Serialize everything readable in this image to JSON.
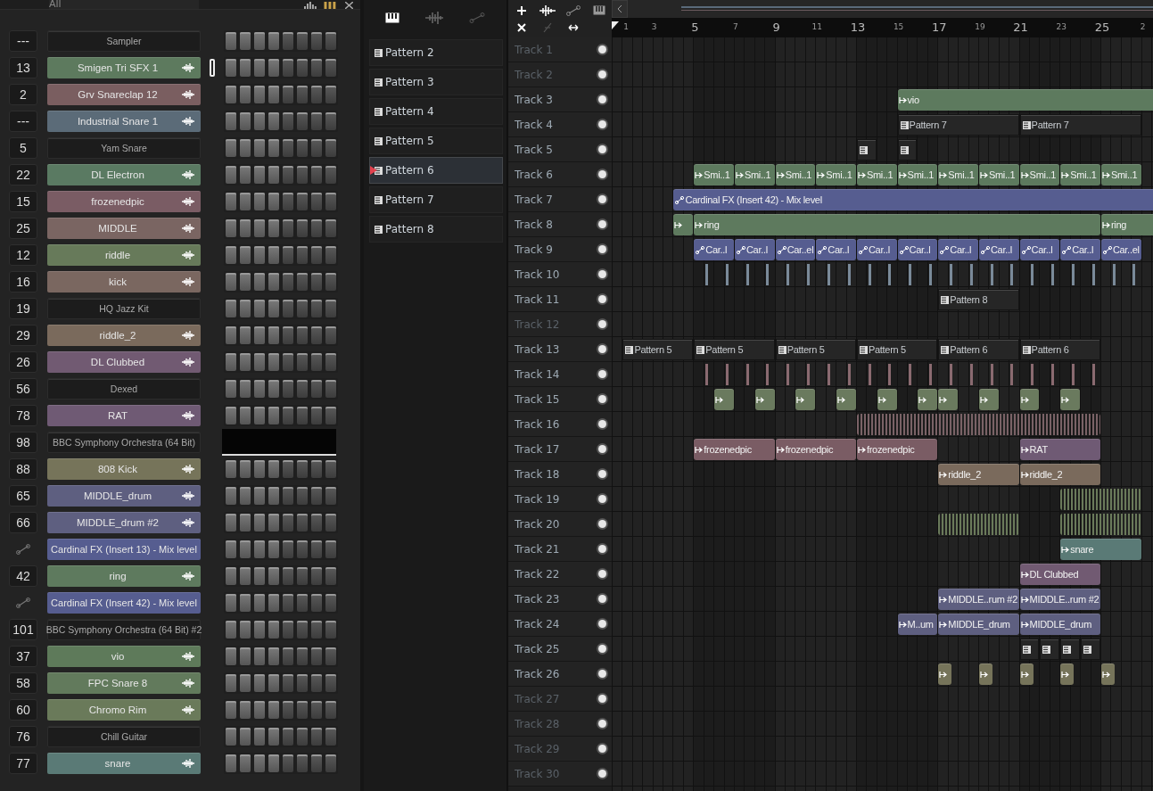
{
  "channel_rack": {
    "filter": "All",
    "channels": [
      {
        "number": "---",
        "name": "Sampler",
        "kind": "plugin",
        "selected": false,
        "display": false
      },
      {
        "number": "13",
        "name": "Smigen Tri SFX 1",
        "kind": "sample",
        "color": "#5d7a5e",
        "selected": true,
        "display": false
      },
      {
        "number": "2",
        "name": "Grv Snareclap 12",
        "kind": "sample",
        "color": "#7a5e60",
        "selected": false,
        "display": false
      },
      {
        "number": "---",
        "name": "Industrial Snare 1",
        "kind": "sample",
        "color": "#5b6b78",
        "selected": false,
        "display": false
      },
      {
        "number": "5",
        "name": "Yam Snare",
        "kind": "plugin",
        "selected": false,
        "display": false
      },
      {
        "number": "22",
        "name": "DL Electron",
        "kind": "sample",
        "color": "#5a7a62",
        "selected": false,
        "display": false
      },
      {
        "number": "15",
        "name": "frozenedpic",
        "kind": "sample",
        "color": "#7a5c64",
        "selected": false,
        "display": false
      },
      {
        "number": "25",
        "name": "MIDDLE",
        "kind": "sample",
        "color": "#7a6562",
        "selected": false,
        "display": false
      },
      {
        "number": "12",
        "name": "riddle",
        "kind": "sample",
        "color": "#677a5a",
        "selected": false,
        "display": false
      },
      {
        "number": "16",
        "name": "kick",
        "kind": "sample",
        "color": "#7a6760",
        "selected": false,
        "display": false
      },
      {
        "number": "19",
        "name": "HQ Jazz Kit",
        "kind": "plugin",
        "selected": false,
        "display": false
      },
      {
        "number": "29",
        "name": "riddle_2",
        "kind": "sample",
        "color": "#7a6a5c",
        "selected": false,
        "display": false
      },
      {
        "number": "26",
        "name": "DL Clubbed",
        "kind": "sample",
        "color": "#715a72",
        "selected": false,
        "display": false
      },
      {
        "number": "56",
        "name": "Dexed",
        "kind": "plugin",
        "selected": false,
        "display": false
      },
      {
        "number": "78",
        "name": "RAT",
        "kind": "sample",
        "color": "#6f5a74",
        "selected": false,
        "display": false
      },
      {
        "number": "98",
        "name": "BBC Symphony Orchestra (64 Bit)",
        "kind": "plugin",
        "selected": false,
        "display": true
      },
      {
        "number": "88",
        "name": "808 Kick",
        "kind": "sample",
        "color": "#76745a",
        "selected": false,
        "display": false
      },
      {
        "number": "65",
        "name": "MIDDLE_drum",
        "kind": "sample",
        "color": "#5e5f80",
        "selected": false,
        "display": false
      },
      {
        "number": "66",
        "name": "MIDDLE_drum #2",
        "kind": "sample",
        "color": "#5e5f80",
        "selected": false,
        "display": false
      },
      {
        "name": "Cardinal FX (Insert 13) - Mix level",
        "kind": "automation",
        "color": "#565d90",
        "selected": false,
        "display": false
      },
      {
        "number": "42",
        "name": "ring",
        "kind": "sample",
        "color": "#5e7a5e",
        "selected": false,
        "display": false
      },
      {
        "name": "Cardinal FX (Insert 42) - Mix level",
        "kind": "automation",
        "color": "#565d90",
        "selected": false,
        "display": false
      },
      {
        "number": "101",
        "name": "BBC Symphony Orchestra (64 Bit) #2",
        "kind": "plugin",
        "selected": false,
        "display": false
      },
      {
        "number": "37",
        "name": "vio",
        "kind": "sample",
        "color": "#5e7a5a",
        "selected": false,
        "display": false
      },
      {
        "number": "58",
        "name": "FPC Snare 8",
        "kind": "sample",
        "color": "#627a5c",
        "selected": false,
        "display": false
      },
      {
        "number": "60",
        "name": "Chromo Rim",
        "kind": "sample",
        "color": "#6a7a5a",
        "selected": false,
        "display": false
      },
      {
        "number": "76",
        "name": "Chill Guitar",
        "kind": "plugin",
        "selected": false,
        "display": false
      },
      {
        "number": "77",
        "name": "snare",
        "kind": "sample",
        "color": "#5a7a76",
        "selected": false,
        "display": false
      }
    ]
  },
  "patterns": [
    {
      "name": "Pattern 2",
      "selected": false
    },
    {
      "name": "Pattern 3",
      "selected": false
    },
    {
      "name": "Pattern 4",
      "selected": false
    },
    {
      "name": "Pattern 5",
      "selected": false
    },
    {
      "name": "Pattern 6",
      "selected": true
    },
    {
      "name": "Pattern 7",
      "selected": false
    },
    {
      "name": "Pattern 8",
      "selected": false
    }
  ],
  "playlist": {
    "ruler": [
      "1",
      "3",
      "5",
      "7",
      "9",
      "11",
      "13",
      "15",
      "17",
      "19",
      "21",
      "23",
      "25",
      "2"
    ],
    "tracks": [
      {
        "name": "Track 1",
        "dimmed": true
      },
      {
        "name": "Track 2",
        "dimmed": true
      },
      {
        "name": "Track 3",
        "dimmed": false,
        "clips": [
          {
            "kind": "audio",
            "label": "vio",
            "color": "#5d7a5e"
          }
        ]
      },
      {
        "name": "Track 4",
        "dimmed": false,
        "clips": [
          {
            "kind": "pattern",
            "label": "Pattern 7",
            "color": "#262626"
          },
          {
            "kind": "pattern",
            "label": "Pattern 7",
            "color": "#262626"
          }
        ]
      },
      {
        "name": "Track 5",
        "dimmed": false,
        "clips": [
          {
            "kind": "pattern",
            "color": "#262626"
          },
          {
            "kind": "pattern",
            "color": "#262626"
          }
        ]
      },
      {
        "name": "Track 6",
        "dimmed": false,
        "clips": [
          {
            "kind": "audio",
            "label": "Smi..1",
            "color": "#5d7a5e"
          },
          {
            "kind": "audio",
            "label": "Smi..1",
            "color": "#5d7a5e"
          },
          {
            "kind": "audio",
            "label": "Smi..1",
            "color": "#5d7a5e"
          },
          {
            "kind": "audio",
            "label": "Smi..1",
            "color": "#5d7a5e"
          },
          {
            "kind": "audio",
            "label": "Smi..1",
            "color": "#5d7a5e"
          },
          {
            "kind": "audio",
            "label": "Smi..1",
            "color": "#5d7a5e"
          },
          {
            "kind": "audio",
            "label": "Smi..1",
            "color": "#5d7a5e"
          },
          {
            "kind": "audio",
            "label": "Smi..1",
            "color": "#5d7a5e"
          },
          {
            "kind": "audio",
            "label": "Smi..1",
            "color": "#5d7a5e"
          },
          {
            "kind": "audio",
            "label": "Smi..1",
            "color": "#5d7a5e"
          },
          {
            "kind": "audio",
            "label": "Smi..1",
            "color": "#5d7a5e"
          }
        ]
      },
      {
        "name": "Track 7",
        "dimmed": false,
        "clips": [
          {
            "kind": "automation",
            "label": "Cardinal FX (Insert 42) - Mix level",
            "color": "#565d90"
          }
        ]
      },
      {
        "name": "Track 8",
        "dimmed": false,
        "clips": [
          {
            "kind": "audio",
            "color": "#5e7a5e"
          },
          {
            "kind": "audio",
            "label": "ring",
            "color": "#5e7a5e"
          },
          {
            "kind": "audio",
            "label": "ring",
            "color": "#5e7a5e"
          }
        ]
      },
      {
        "name": "Track 9",
        "dimmed": false,
        "clips": [
          {
            "kind": "automation",
            "label": "Car..l",
            "color": "#565d90"
          },
          {
            "kind": "automation",
            "label": "Car..l",
            "color": "#565d90"
          },
          {
            "kind": "automation",
            "label": "Car..el",
            "color": "#565d90"
          },
          {
            "kind": "automation",
            "label": "Car..l",
            "color": "#565d90"
          },
          {
            "kind": "automation",
            "label": "Car..l",
            "color": "#565d90"
          },
          {
            "kind": "automation",
            "label": "Car..l",
            "color": "#565d90"
          },
          {
            "kind": "automation",
            "label": "Car..l",
            "color": "#565d90"
          },
          {
            "kind": "automation",
            "label": "Car..l",
            "color": "#565d90"
          },
          {
            "kind": "automation",
            "label": "Car..l",
            "color": "#565d90"
          },
          {
            "kind": "automation",
            "label": "Car..l",
            "color": "#565d90"
          },
          {
            "kind": "automation",
            "label": "Car..el",
            "color": "#565d90"
          }
        ]
      },
      {
        "name": "Track 10",
        "dimmed": false,
        "clips": [
          {
            "kind": "hits",
            "color": "#7a8a99"
          }
        ]
      },
      {
        "name": "Track 11",
        "dimmed": false,
        "clips": [
          {
            "kind": "pattern",
            "label": "Pattern 8",
            "color": "#262626"
          }
        ]
      },
      {
        "name": "Track 12",
        "dimmed": true
      },
      {
        "name": "Track 13",
        "dimmed": false,
        "clips": [
          {
            "kind": "pattern",
            "label": "Pattern 5",
            "color": "#262626"
          },
          {
            "kind": "pattern",
            "label": "Pattern 5",
            "color": "#262626"
          },
          {
            "kind": "pattern",
            "label": "Pattern 5",
            "color": "#262626"
          },
          {
            "kind": "pattern",
            "label": "Pattern 5",
            "color": "#262626"
          },
          {
            "kind": "pattern",
            "label": "Pattern 6",
            "color": "#262626"
          },
          {
            "kind": "pattern",
            "label": "Pattern 6",
            "color": "#262626"
          }
        ]
      },
      {
        "name": "Track 14",
        "dimmed": false,
        "clips": [
          {
            "kind": "hits",
            "color": "#8a6a70"
          }
        ]
      },
      {
        "name": "Track 15",
        "dimmed": false,
        "clips": [
          {
            "kind": "audio",
            "color": "#6a7a5e"
          },
          {
            "kind": "audio",
            "color": "#6a7a5e"
          },
          {
            "kind": "audio",
            "color": "#6a7a5e"
          },
          {
            "kind": "audio",
            "color": "#6a7a5e"
          },
          {
            "kind": "audio",
            "color": "#6a7a5e"
          },
          {
            "kind": "audio",
            "color": "#6a7a5e"
          },
          {
            "kind": "audio",
            "color": "#6a7a5e"
          },
          {
            "kind": "audio",
            "color": "#6a7a5e"
          },
          {
            "kind": "audio",
            "color": "#6a7a5e"
          },
          {
            "kind": "audio",
            "color": "#6a7a5e"
          }
        ]
      },
      {
        "name": "Track 16",
        "dimmed": false,
        "clips": [
          {
            "kind": "dense",
            "color": "#7a6266"
          }
        ]
      },
      {
        "name": "Track 17",
        "dimmed": false,
        "clips": [
          {
            "kind": "audio",
            "label": "frozenedpic",
            "color": "#7a5c64"
          },
          {
            "kind": "audio",
            "label": "frozenedpic",
            "color": "#7a5c64"
          },
          {
            "kind": "audio",
            "label": "frozenedpic",
            "color": "#7a5c64"
          },
          {
            "kind": "audio",
            "label": "RAT",
            "color": "#6f5a74"
          }
        ]
      },
      {
        "name": "Track 18",
        "dimmed": false,
        "clips": [
          {
            "kind": "audio",
            "label": "riddle_2",
            "color": "#7a6a5c"
          },
          {
            "kind": "audio",
            "label": "riddle_2",
            "color": "#7a6a5c"
          }
        ]
      },
      {
        "name": "Track 19",
        "dimmed": false,
        "clips": [
          {
            "kind": "dense",
            "color": "#6a7a5a"
          }
        ]
      },
      {
        "name": "Track 20",
        "dimmed": false,
        "clips": [
          {
            "kind": "dense",
            "color": "#6a7a5a"
          },
          {
            "kind": "dense",
            "color": "#6a7a5a"
          }
        ]
      },
      {
        "name": "Track 21",
        "dimmed": false,
        "clips": [
          {
            "kind": "audio",
            "label": "snare",
            "color": "#5a7a76"
          }
        ]
      },
      {
        "name": "Track 22",
        "dimmed": false,
        "clips": [
          {
            "kind": "audio",
            "label": "DL Clubbed",
            "color": "#715a72"
          }
        ]
      },
      {
        "name": "Track 23",
        "dimmed": false,
        "clips": [
          {
            "kind": "audio",
            "label": "MIDDLE..rum #2",
            "color": "#5e5f80"
          },
          {
            "kind": "audio",
            "label": "MIDDLE..rum #2",
            "color": "#5e5f80"
          }
        ]
      },
      {
        "name": "Track 24",
        "dimmed": false,
        "clips": [
          {
            "kind": "audio",
            "label": "M..um",
            "color": "#5e5f80"
          },
          {
            "kind": "audio",
            "label": "MIDDLE_drum",
            "color": "#5e5f80"
          },
          {
            "kind": "audio",
            "label": "MIDDLE_drum",
            "color": "#5e5f80"
          }
        ]
      },
      {
        "name": "Track 25",
        "dimmed": false,
        "clips": [
          {
            "kind": "pattern",
            "color": "#262626"
          },
          {
            "kind": "pattern",
            "color": "#262626"
          },
          {
            "kind": "pattern",
            "color": "#262626"
          },
          {
            "kind": "pattern",
            "color": "#262626"
          }
        ]
      },
      {
        "name": "Track 26",
        "dimmed": false,
        "clips": [
          {
            "kind": "audio",
            "color": "#76745a"
          },
          {
            "kind": "audio",
            "color": "#76745a"
          },
          {
            "kind": "audio",
            "color": "#76745a"
          },
          {
            "kind": "audio",
            "color": "#76745a"
          },
          {
            "kind": "audio",
            "color": "#76745a"
          }
        ]
      },
      {
        "name": "Track 27",
        "dimmed": true
      },
      {
        "name": "Track 28",
        "dimmed": true
      },
      {
        "name": "Track 29",
        "dimmed": true
      },
      {
        "name": "Track 30",
        "dimmed": true
      }
    ]
  }
}
